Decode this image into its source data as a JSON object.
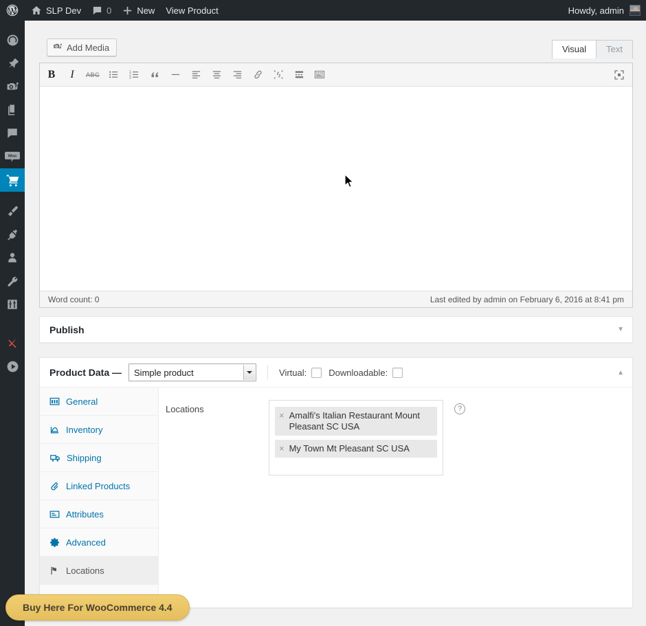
{
  "adminbar": {
    "logo_icon": "wordpress-logo-icon",
    "site_icon": "home-icon",
    "site_name": "SLP Dev",
    "comments_icon": "comment-bubble-icon",
    "comments_count": "0",
    "new_icon": "plus-icon",
    "new_label": "New",
    "view_product_label": "View Product",
    "howdy": "Howdy, admin",
    "avatar_name": "avatar"
  },
  "sidebar": {
    "items": [
      {
        "name": "dashboard",
        "icon": "dashboard-gauge-icon",
        "current": false
      },
      {
        "name": "posts",
        "icon": "pin-icon",
        "current": false
      },
      {
        "name": "media",
        "icon": "media-camera-music-icon",
        "current": false
      },
      {
        "name": "pages",
        "icon": "pages-icon",
        "current": false
      },
      {
        "name": "comments",
        "icon": "comment-bubble-icon",
        "current": false
      },
      {
        "name": "woocommerce",
        "icon": "woo-icon",
        "current": false
      },
      {
        "name": "products",
        "icon": "shopping-cart-icon",
        "current": true
      },
      {
        "name": "appearance",
        "icon": "paintbrush-icon",
        "current": false
      },
      {
        "name": "plugins",
        "icon": "plug-icon",
        "current": false
      },
      {
        "name": "users",
        "icon": "user-icon",
        "current": false
      },
      {
        "name": "tools",
        "icon": "wrench-icon",
        "current": false
      },
      {
        "name": "settings",
        "icon": "settings-sliders-icon",
        "current": false
      },
      {
        "name": "store-locator-plus",
        "icon": "slp-marker-icon",
        "current": false
      },
      {
        "name": "media-player",
        "icon": "play-circle-icon",
        "current": false
      }
    ]
  },
  "editor": {
    "add_media_label": "Add Media",
    "add_media_icon": "add-media-icon",
    "tab_visual": "Visual",
    "tab_text": "Text",
    "toolbar": [
      {
        "name": "bold-button",
        "glyph": "B",
        "kind": "bold"
      },
      {
        "name": "italic-button",
        "glyph": "I",
        "kind": "ital"
      },
      {
        "name": "strikethrough-button",
        "glyph": "ABC",
        "kind": "strike"
      },
      {
        "name": "bulleted-list-button",
        "glyph": "",
        "kind": "ul"
      },
      {
        "name": "numbered-list-button",
        "glyph": "",
        "kind": "ol"
      },
      {
        "name": "blockquote-button",
        "glyph": "“",
        "kind": "quote"
      },
      {
        "name": "horizontal-rule-button",
        "glyph": "",
        "kind": "hr"
      },
      {
        "name": "align-left-button",
        "glyph": "",
        "kind": "alignleft"
      },
      {
        "name": "align-center-button",
        "glyph": "",
        "kind": "aligncenter"
      },
      {
        "name": "align-right-button",
        "glyph": "",
        "kind": "alignright"
      },
      {
        "name": "insert-link-button",
        "glyph": "",
        "kind": "link"
      },
      {
        "name": "unlink-button",
        "glyph": "",
        "kind": "unlink"
      },
      {
        "name": "read-more-button",
        "glyph": "",
        "kind": "more"
      },
      {
        "name": "toolbar-toggle-button",
        "glyph": "",
        "kind": "kitchensink"
      }
    ],
    "fullscreen_icon": "fullscreen-icon",
    "body_text": "",
    "word_count": "Word count: 0",
    "last_edited": "Last edited by admin on February 6, 2016 at 8:41 pm"
  },
  "publish": {
    "title": "Publish",
    "toggle_icon": "chevron-down-icon",
    "toggle_glyph": "▼"
  },
  "product_data": {
    "title": "Product Data —",
    "product_type": "Simple product",
    "virtual_label": "Virtual:",
    "virtual_checked": false,
    "downloadable_label": "Downloadable:",
    "downloadable_checked": false,
    "toggle_glyph": "▲",
    "tabs": [
      {
        "label": "General",
        "icon": "general-icon",
        "active": false
      },
      {
        "label": "Inventory",
        "icon": "inventory-chart-icon",
        "active": false
      },
      {
        "label": "Shipping",
        "icon": "shipping-truck-icon",
        "active": false
      },
      {
        "label": "Linked Products",
        "icon": "link-paperclip-icon",
        "active": false
      },
      {
        "label": "Attributes",
        "icon": "attributes-icon",
        "active": false
      },
      {
        "label": "Advanced",
        "icon": "gear-icon",
        "active": false
      },
      {
        "label": "Locations",
        "icon": "map-marker-flag-icon",
        "active": true
      }
    ],
    "locations_field": {
      "label": "Locations",
      "help_icon": "help-question-icon",
      "help_glyph": "?",
      "remove_glyph": "×",
      "tokens": [
        "Amalfi's Italian Restaurant Mount Pleasant SC USA",
        "My Town Mt Pleasant SC USA"
      ]
    }
  },
  "footer": {
    "buy_badge_label": "Buy Here For WooCommerce 4.4"
  },
  "colors": {
    "admin_bar": "#23282d",
    "accent_blue": "#0085ba",
    "link_blue": "#0073aa",
    "badge_gold": "#e5be5e",
    "content_bg": "#f1f1f1"
  }
}
